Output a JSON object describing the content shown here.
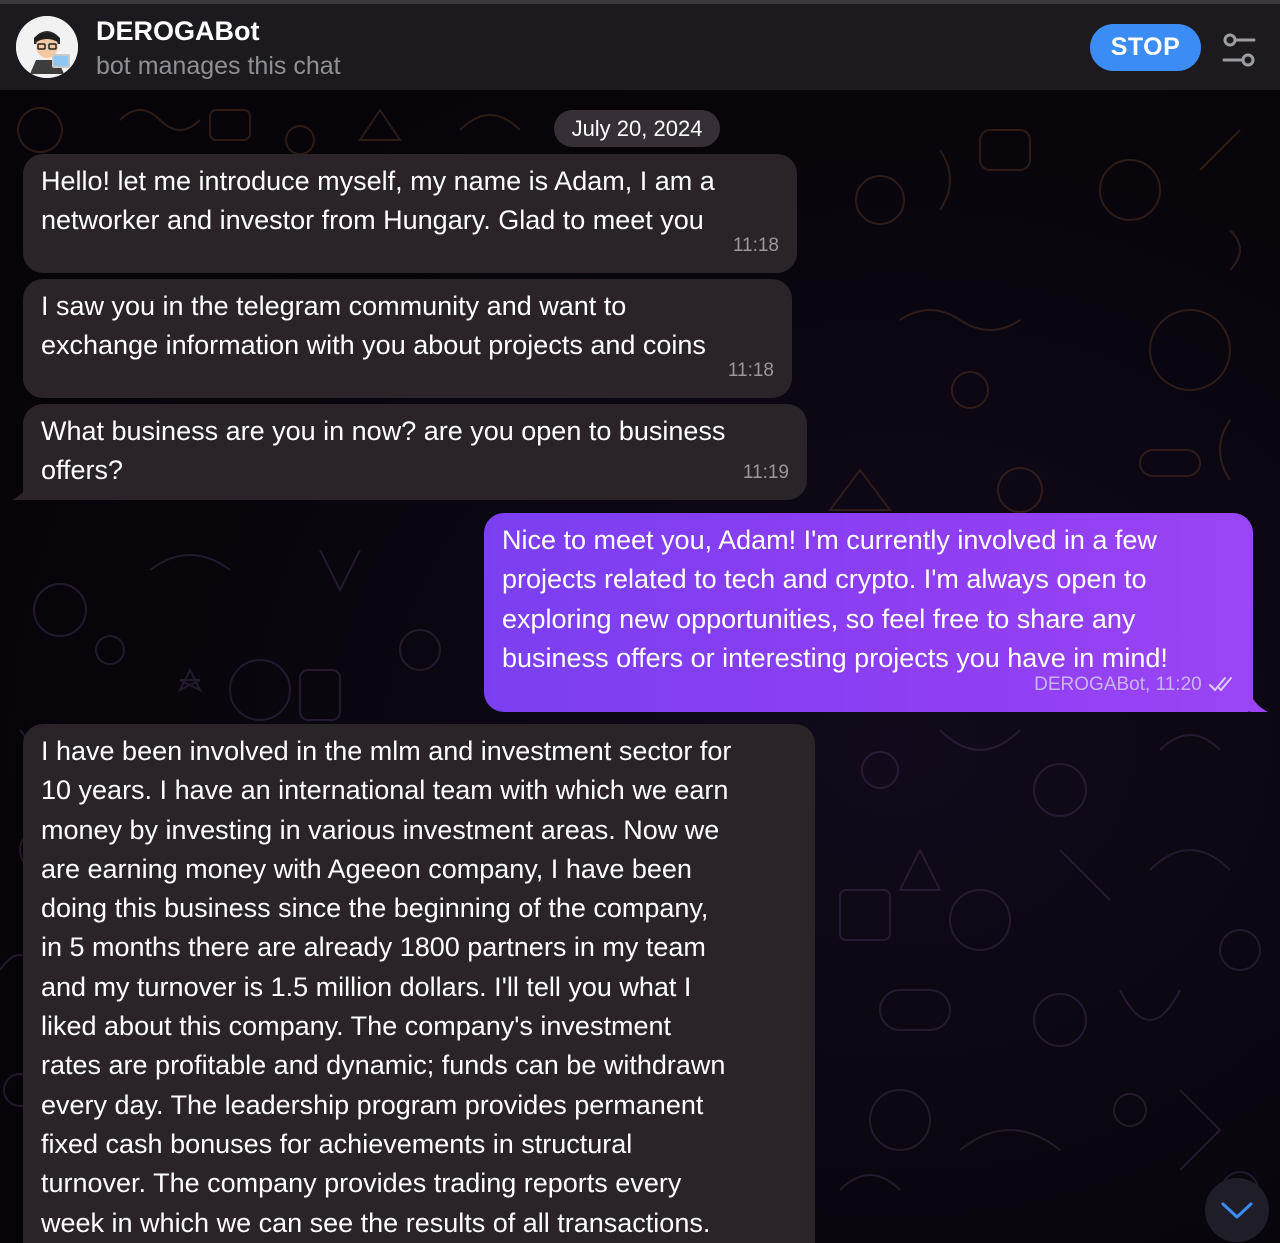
{
  "header": {
    "title": "DEROGABot",
    "subtitle": "bot manages this chat",
    "stop_label": "STOP",
    "icons": {
      "avatar": "bot-avatar",
      "settings": "sliders-icon"
    }
  },
  "date_separator": "July 20, 2024",
  "messages": [
    {
      "direction": "incoming",
      "text": "Hello! let me introduce myself, my name is Adam, I am a\nnetworker and investor from Hungary. Glad to meet you",
      "time": "11:18"
    },
    {
      "direction": "incoming",
      "text": "I saw you in the telegram community and want to\nexchange information with you about projects and coins",
      "time": "11:18"
    },
    {
      "direction": "incoming",
      "text": "What business are you in now? are you open to business\noffers?",
      "time": "11:19"
    },
    {
      "direction": "outgoing",
      "text": "Nice to meet you, Adam! I'm currently involved in a few\nprojects related to tech and crypto. I'm always open to\nexploring new opportunities, so feel free to share any\nbusiness offers or interesting projects you have in mind!",
      "time": "DEROGABot, 11:20"
    },
    {
      "direction": "incoming",
      "text": "I have been involved in the mlm and investment sector for\n10 years. I have an international team with which we earn\nmoney by investing in various investment areas. Now we\nare earning money with Ageeon company, I have been\ndoing this business since the beginning of the company,\nin 5 months there are already 1800 partners in my team\nand my turnover is 1.5 million dollars. I'll tell you what I\nliked about this company. The company's investment\nrates are profitable and dynamic; funds can be withdrawn\nevery day. The leadership program provides permanent\nfixed cash bonuses for achievements in structural\nturnover. The company provides trading reports every\nweek in which we can see the results of all transactions."
    }
  ],
  "colors": {
    "header_bg": "#1c1a1f",
    "incoming_bubble": "#2a2429",
    "outgoing_bubble": "#8a3ef3",
    "accent": "#3b8df5"
  },
  "scroll_icon": "chevron-down-icon"
}
